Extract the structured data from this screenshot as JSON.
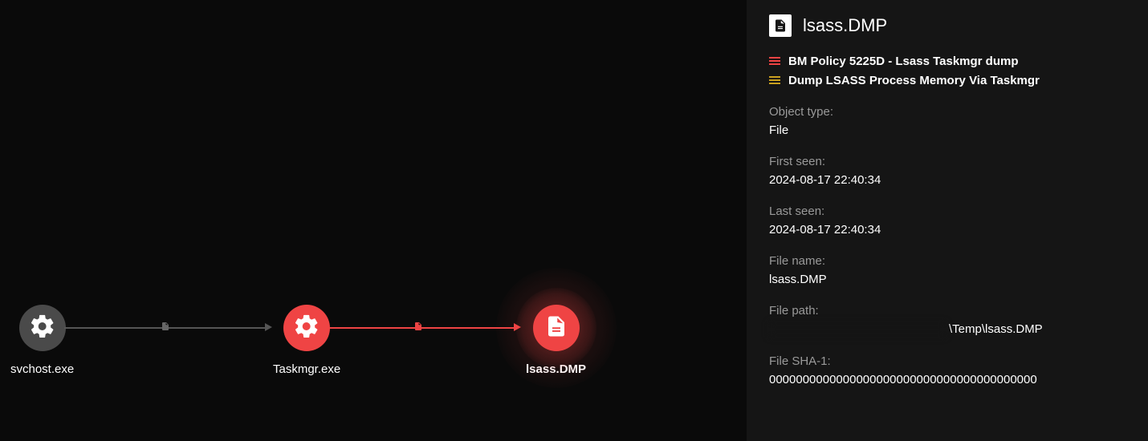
{
  "graph": {
    "nodes": {
      "svchost": {
        "label": "svchost.exe",
        "icon": "gear-icon"
      },
      "taskmgr": {
        "label": "Taskmgr.exe",
        "icon": "gear-icon"
      },
      "lsass": {
        "label": "lsass.DMP",
        "icon": "document-icon"
      }
    },
    "edge_mid_icon": "file-create-icon"
  },
  "panel": {
    "title": "lsass.DMP",
    "tags": [
      {
        "color": "red",
        "text": "BM Policy 5225D - Lsass Taskmgr dump"
      },
      {
        "color": "yellow",
        "text": "Dump LSASS Process Memory Via Taskmgr"
      }
    ],
    "fields": {
      "object_type": {
        "label": "Object type:",
        "value": "File"
      },
      "first_seen": {
        "label": "First seen:",
        "value": "2024-08-17 22:40:34"
      },
      "last_seen": {
        "label": "Last seen:",
        "value": "2024-08-17 22:40:34"
      },
      "file_name": {
        "label": "File name:",
        "value": "lsass.DMP"
      },
      "file_path": {
        "label": "File path:",
        "value_suffix": "\\Temp\\lsass.DMP"
      },
      "file_sha1": {
        "label": "File SHA-1:",
        "value": "0000000000000000000000000000000000000000"
      }
    }
  }
}
